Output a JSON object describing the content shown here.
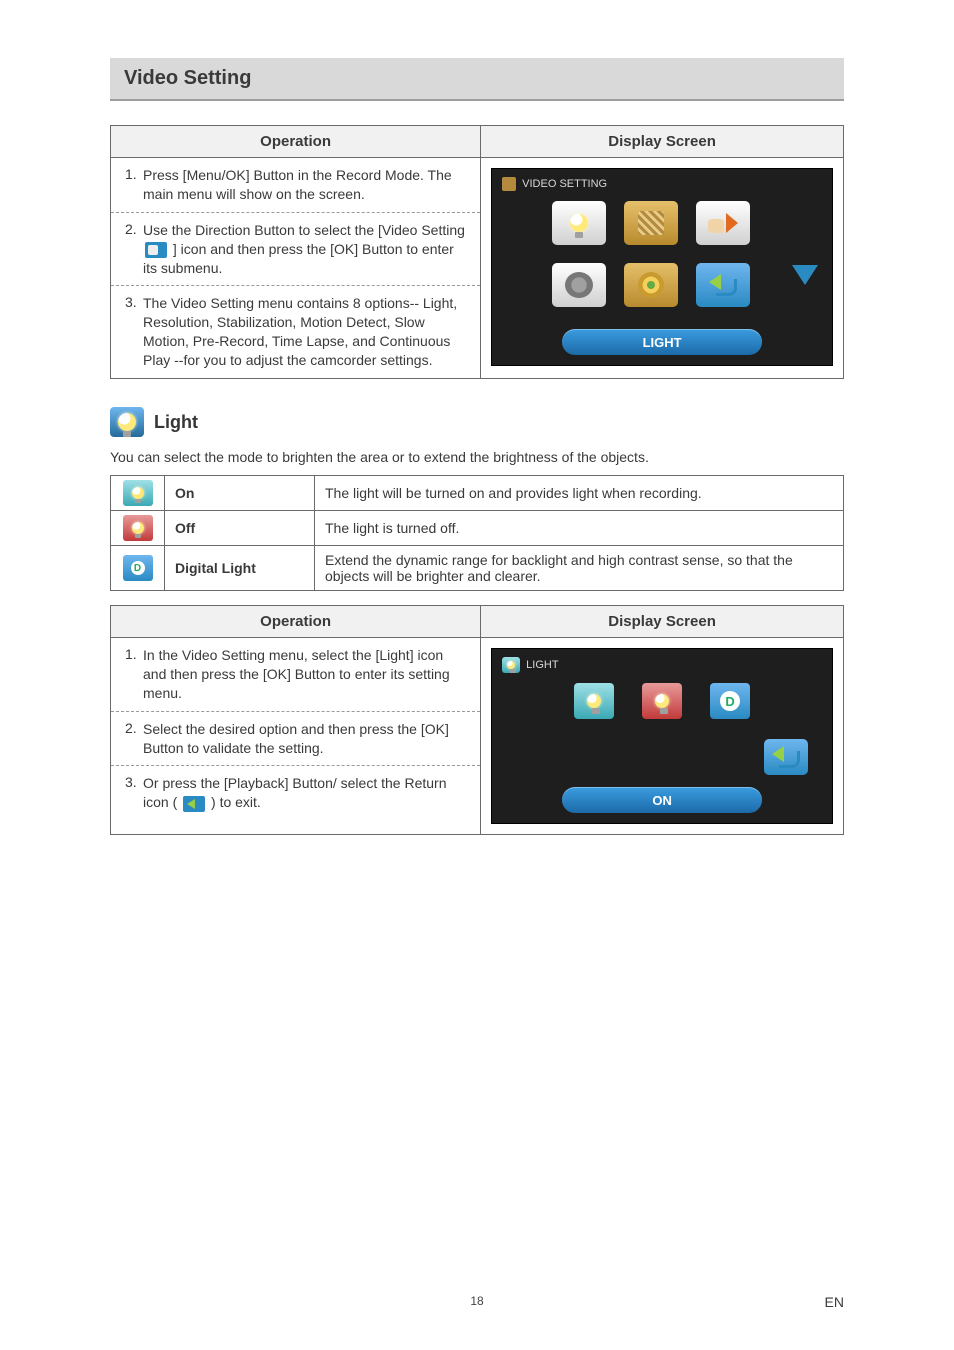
{
  "title": "Video Setting",
  "table1": {
    "headers": {
      "op": "Operation",
      "ds": "Display Screen"
    },
    "rows": [
      {
        "num": "1.",
        "text_a": "Press [Menu/OK] Button in the Record Mode. The main menu will show on the screen."
      },
      {
        "num": "2.",
        "text_a": "Use the Direction Button to select the [Video Setting ",
        "text_b": " ] icon and then press the [OK] Button to enter its submenu."
      },
      {
        "num": "3.",
        "text_a": "The Video Setting menu contains 8 options-- Light, Resolution, Stabilization, Motion Detect, Slow Motion, Pre-Record, Time Lapse, and Continuous Play --for you to adjust the camcorder settings."
      }
    ],
    "screen": {
      "title": "VIDEO SETTING",
      "caption": "LIGHT"
    }
  },
  "light_section": {
    "heading": "Light",
    "intro": "You can select the mode to brighten the area or to extend the brightness of the objects.",
    "features": [
      {
        "label": "On",
        "desc": "The light will be turned on and provides light when recording."
      },
      {
        "label": "Off",
        "desc": "The light is turned off."
      },
      {
        "label": "Digital Light",
        "desc": "Extend the dynamic range for backlight and high contrast sense, so that the objects will be brighter and clearer."
      }
    ]
  },
  "table2": {
    "headers": {
      "op": "Operation",
      "ds": "Display Screen"
    },
    "rows": [
      {
        "num": "1.",
        "text_a": "In the Video Setting menu, select the [Light] icon and then press the [OK] Button to enter its setting menu."
      },
      {
        "num": "2.",
        "text_a": "Select the desired option and then press the [OK] Button to validate the setting."
      },
      {
        "num": "3.",
        "text_a": "Or press the [Playback] Button/ select the Return icon (",
        "text_b": ") to exit."
      }
    ],
    "screen": {
      "title": "LIGHT",
      "caption": "ON"
    }
  },
  "footer": {
    "page": "18",
    "lang": "EN"
  }
}
